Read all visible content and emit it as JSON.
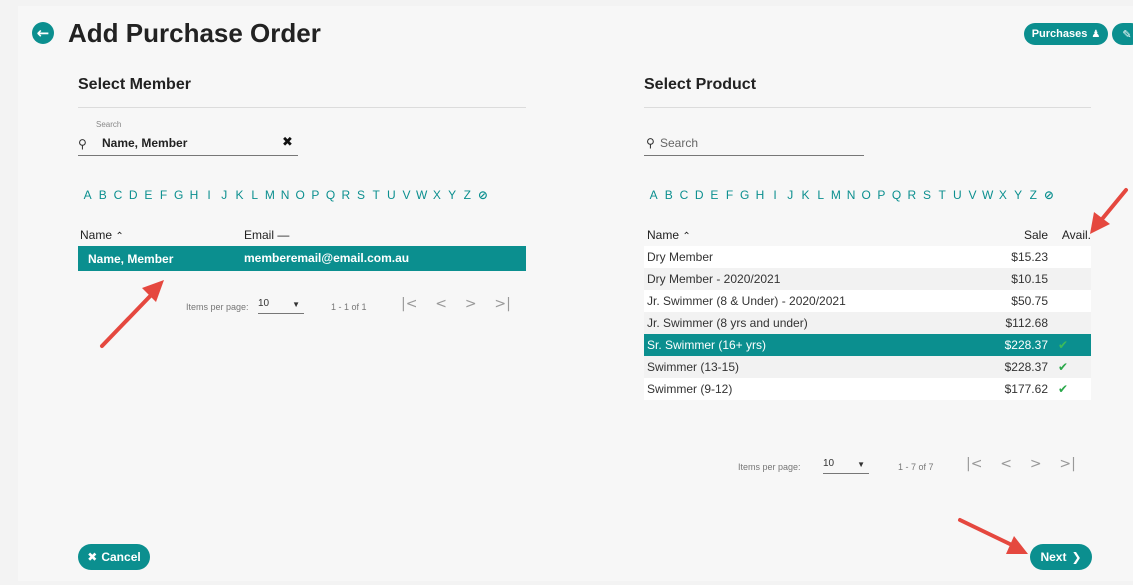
{
  "header": {
    "title": "Add Purchase Order",
    "back_icon": "arrow-left-icon",
    "purchases_label": "Purchases",
    "accent": "#0b8f8f"
  },
  "member": {
    "section_title": "Select Member",
    "search_label": "Search",
    "search_value": "Name, Member",
    "letters": [
      "A",
      "B",
      "C",
      "D",
      "E",
      "F",
      "G",
      "H",
      "I",
      "J",
      "K",
      "L",
      "M",
      "N",
      "O",
      "P",
      "Q",
      "R",
      "S",
      "T",
      "U",
      "V",
      "W",
      "X",
      "Y",
      "Z"
    ],
    "col_name": "Name",
    "col_email": "Email",
    "rows": [
      {
        "name": "Name, Member",
        "email": "memberemail@email.com.au"
      }
    ],
    "items_per_page_label": "Items per page:",
    "items_per_page": "10",
    "range": "1 - 1 of 1"
  },
  "product": {
    "section_title": "Select Product",
    "search_placeholder": "Search",
    "letters": [
      "A",
      "B",
      "C",
      "D",
      "E",
      "F",
      "G",
      "H",
      "I",
      "J",
      "K",
      "L",
      "M",
      "N",
      "O",
      "P",
      "Q",
      "R",
      "S",
      "T",
      "U",
      "V",
      "W",
      "X",
      "Y",
      "Z"
    ],
    "col_name": "Name",
    "col_sale": "Sale",
    "col_avail": "Avail.",
    "rows": [
      {
        "name": "Dry Member",
        "sale": "$15.23",
        "avail": false
      },
      {
        "name": "Dry Member - 2020/2021",
        "sale": "$10.15",
        "avail": false
      },
      {
        "name": "Jr. Swimmer (8 & Under) - 2020/2021",
        "sale": "$50.75",
        "avail": false
      },
      {
        "name": "Jr. Swimmer (8 yrs and under)",
        "sale": "$112.68",
        "avail": false
      },
      {
        "name": "Sr. Swimmer (16+ yrs)",
        "sale": "$228.37",
        "avail": true
      },
      {
        "name": "Swimmer (13-15)",
        "sale": "$228.37",
        "avail": true
      },
      {
        "name": "Swimmer (9-12)",
        "sale": "$177.62",
        "avail": true
      }
    ],
    "items_per_page_label": "Items per page:",
    "items_per_page": "10",
    "range": "1 - 7 of 7"
  },
  "footer": {
    "cancel_label": "Cancel",
    "next_label": "Next"
  }
}
